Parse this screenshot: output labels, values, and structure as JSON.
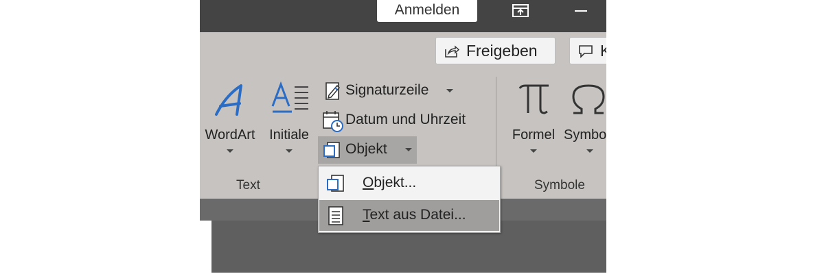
{
  "titlebar": {
    "signin_label": "Anmelden",
    "icons": [
      "ribbon-display-options-icon",
      "minimize-icon"
    ]
  },
  "ribbon": {
    "share_label": "Freigeben",
    "comments_label": "K",
    "text_group": {
      "wordart_label": "WordArt",
      "dropcap_label": "Initiale",
      "signature_label": "Signaturzeile",
      "datetime_label": "Datum und Uhrzeit",
      "object_label": "Objekt",
      "group_label": "Text"
    },
    "symbols_group": {
      "equation_label": "Formel",
      "symbol_label": "Symbo",
      "group_label": "Symbole"
    }
  },
  "object_menu": {
    "items": [
      {
        "accel": "O",
        "rest": "bjekt...",
        "highlighted": false,
        "icon": "object-icon"
      },
      {
        "accel": "T",
        "rest": "ext aus Datei...",
        "highlighted": true,
        "icon": "text-file-icon"
      }
    ]
  },
  "colors": {
    "titlebar": "#444444",
    "ribbon": "#c6c3c0",
    "accent_blue": "#2b6cc4",
    "menu_highlight": "#9f9e9d"
  }
}
